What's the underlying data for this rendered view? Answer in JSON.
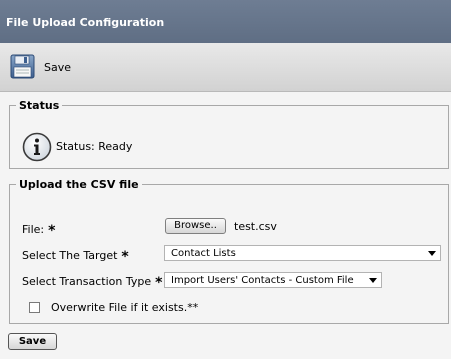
{
  "header": {
    "title": "File Upload Configuration"
  },
  "toolbar": {
    "save_label": "Save",
    "save_icon": "floppy-disk-icon"
  },
  "status": {
    "legend": "Status",
    "icon": "info-icon",
    "text": "Status: Ready"
  },
  "upload": {
    "legend": "Upload the CSV file",
    "file_label": "File:",
    "required_marker": "*",
    "browse_label": "Browse..",
    "file_name": "test.csv",
    "target_label": "Select The Target",
    "target_value": "Contact Lists",
    "transaction_label": "Select Transaction Type",
    "transaction_value": "Import Users' Contacts - Custom File",
    "overwrite_label": "Overwrite File if it exists.**",
    "overwrite_checked": false
  },
  "footer": {
    "save_label": "Save"
  }
}
